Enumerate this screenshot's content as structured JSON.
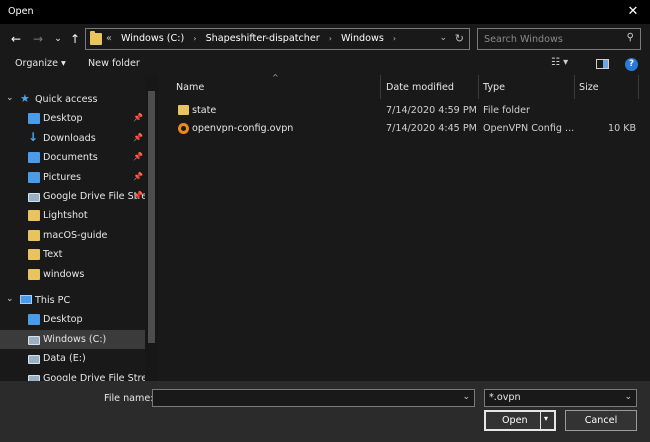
{
  "window": {
    "title": "Open",
    "close_glyph": "✕"
  },
  "nav_buttons": {
    "back": "←",
    "forward": "→",
    "recent": "⌄",
    "up": "↑"
  },
  "address": {
    "lead": "«",
    "crumbs": [
      "Windows (C:)",
      "Shapeshifter-dispatcher",
      "Windows"
    ],
    "sep": "›",
    "dropdown_glyph": "⌄",
    "refresh_glyph": "↻"
  },
  "search": {
    "placeholder": "Search Windows",
    "icon": "search-icon",
    "glyph": "⚲"
  },
  "toolbar": {
    "organize": "Organize ▾",
    "new_folder": "New folder",
    "view_glyph": "☷ ▾",
    "help_glyph": "?"
  },
  "nav": {
    "pin_glyph": "📌",
    "items": [
      {
        "label": "Quick access",
        "icon": "star",
        "glyph": "★",
        "chev": "⌄",
        "indent": 0,
        "pinned": false
      },
      {
        "label": "Desktop",
        "icon": "blue",
        "indent": 1,
        "pinned": true
      },
      {
        "label": "Downloads",
        "icon": "download",
        "glyph": "↓",
        "indent": 1,
        "pinned": true
      },
      {
        "label": "Documents",
        "icon": "blue",
        "indent": 1,
        "pinned": true
      },
      {
        "label": "Pictures",
        "icon": "blue",
        "indent": 1,
        "pinned": true
      },
      {
        "label": "Google Drive File Stre",
        "icon": "drive",
        "indent": 1,
        "pinned": true
      },
      {
        "label": "Lightshot",
        "icon": "folder",
        "indent": 1,
        "pinned": false
      },
      {
        "label": "macOS-guide",
        "icon": "folder",
        "indent": 1,
        "pinned": false
      },
      {
        "label": "Text",
        "icon": "folder",
        "indent": 1,
        "pinned": false
      },
      {
        "label": "windows",
        "icon": "folder",
        "indent": 1,
        "pinned": false
      },
      {
        "label": "This PC",
        "icon": "pc",
        "chev": "⌄",
        "indent": 0,
        "pinned": false,
        "gap": true
      },
      {
        "label": "Desktop",
        "icon": "blue",
        "indent": 1,
        "pinned": false
      },
      {
        "label": "Windows (C:)",
        "icon": "drive",
        "indent": 1,
        "pinned": false,
        "selected": true
      },
      {
        "label": "Data (E:)",
        "icon": "drive",
        "indent": 1,
        "pinned": false
      },
      {
        "label": "Google Drive File Stream",
        "icon": "drive",
        "indent": 1,
        "pinned": false
      }
    ]
  },
  "columns": {
    "name": "Name",
    "date": "Date modified",
    "type": "Type",
    "size": "Size",
    "sort_glyph": "^"
  },
  "files": [
    {
      "name": "state",
      "date": "",
      "type": "File folder",
      "size": "",
      "icon": "folder"
    },
    {
      "name": "openvpn-config.ovpn",
      "date": "7/14/2020 4:45 PM",
      "type": "OpenVPN Config ...",
      "size": "10 KB",
      "icon": "vpn"
    }
  ],
  "folder_date": "7/14/2020 4:59 PM",
  "bottom": {
    "file_name_label": "File name:",
    "file_name_value": "",
    "filter": "*.ovpn",
    "dropdown_glyph": "⌄",
    "open": "Open",
    "open_dd": "▾",
    "cancel": "Cancel"
  }
}
